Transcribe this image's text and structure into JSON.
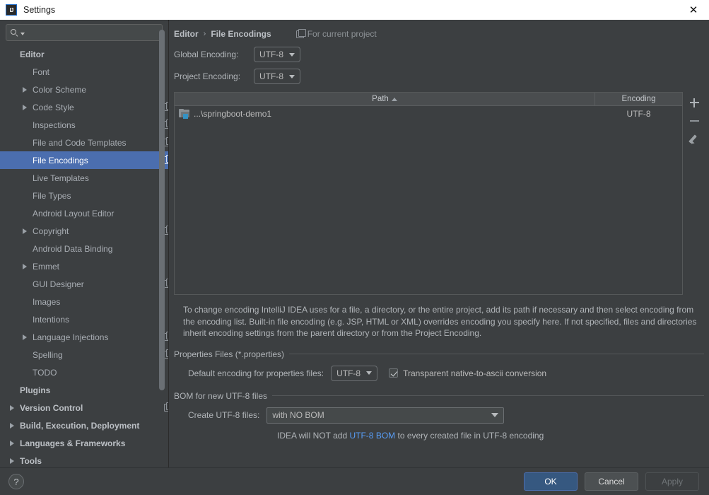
{
  "window": {
    "title": "Settings",
    "icon": "intellij-idea-icon",
    "close_label": "✕"
  },
  "sidebar": {
    "search": {
      "value": "",
      "placeholder": "",
      "icon": "search-icon"
    },
    "items": [
      {
        "label": "Editor",
        "level": 1,
        "bold": true,
        "arrow": false,
        "copy": false
      },
      {
        "label": "Font",
        "level": 2,
        "bold": false,
        "arrow": false,
        "copy": false
      },
      {
        "label": "Color Scheme",
        "level": 2,
        "bold": false,
        "arrow": true,
        "copy": false
      },
      {
        "label": "Code Style",
        "level": 2,
        "bold": false,
        "arrow": true,
        "copy": true
      },
      {
        "label": "Inspections",
        "level": 2,
        "bold": false,
        "arrow": false,
        "copy": true
      },
      {
        "label": "File and Code Templates",
        "level": 2,
        "bold": false,
        "arrow": false,
        "copy": true
      },
      {
        "label": "File Encodings",
        "level": 2,
        "bold": false,
        "arrow": false,
        "copy": true,
        "selected": true
      },
      {
        "label": "Live Templates",
        "level": 2,
        "bold": false,
        "arrow": false,
        "copy": false
      },
      {
        "label": "File Types",
        "level": 2,
        "bold": false,
        "arrow": false,
        "copy": false
      },
      {
        "label": "Android Layout Editor",
        "level": 2,
        "bold": false,
        "arrow": false,
        "copy": false
      },
      {
        "label": "Copyright",
        "level": 2,
        "bold": false,
        "arrow": true,
        "copy": true
      },
      {
        "label": "Android Data Binding",
        "level": 2,
        "bold": false,
        "arrow": false,
        "copy": false
      },
      {
        "label": "Emmet",
        "level": 2,
        "bold": false,
        "arrow": true,
        "copy": false
      },
      {
        "label": "GUI Designer",
        "level": 2,
        "bold": false,
        "arrow": false,
        "copy": true
      },
      {
        "label": "Images",
        "level": 2,
        "bold": false,
        "arrow": false,
        "copy": false
      },
      {
        "label": "Intentions",
        "level": 2,
        "bold": false,
        "arrow": false,
        "copy": false
      },
      {
        "label": "Language Injections",
        "level": 2,
        "bold": false,
        "arrow": true,
        "copy": true
      },
      {
        "label": "Spelling",
        "level": 2,
        "bold": false,
        "arrow": false,
        "copy": true
      },
      {
        "label": "TODO",
        "level": 2,
        "bold": false,
        "arrow": false,
        "copy": false
      },
      {
        "label": "Plugins",
        "level": 1,
        "bold": true,
        "arrow": false,
        "copy": false
      },
      {
        "label": "Version Control",
        "level": 1,
        "bold": true,
        "arrow": true,
        "copy": true
      },
      {
        "label": "Build, Execution, Deployment",
        "level": 1,
        "bold": true,
        "arrow": true,
        "copy": false
      },
      {
        "label": "Languages & Frameworks",
        "level": 1,
        "bold": true,
        "arrow": true,
        "copy": false
      },
      {
        "label": "Tools",
        "level": 1,
        "bold": true,
        "arrow": true,
        "copy": false
      }
    ]
  },
  "main": {
    "breadcrumb": {
      "parent": "Editor",
      "separator": "›",
      "current": "File Encodings"
    },
    "for_current_project": "For current project",
    "global_encoding": {
      "label": "Global Encoding:",
      "value": "UTF-8"
    },
    "project_encoding": {
      "label": "Project Encoding:",
      "value": "UTF-8"
    },
    "table": {
      "columns": [
        "Path",
        "Encoding"
      ],
      "sort_column": "Path",
      "sort_direction": "ascending",
      "rows": [
        {
          "path": "...\\springboot-demo1",
          "encoding": "UTF-8"
        }
      ]
    },
    "tools": {
      "add": "+",
      "remove": "−",
      "edit": "edit"
    },
    "description": "To change encoding IntelliJ IDEA uses for a file, a directory, or the entire project, add its path if necessary and then select encoding from the encoding list. Built-in file encoding (e.g. JSP, HTML or XML) overrides encoding you specify here. If not specified, files and directories inherit encoding settings from the parent directory or from the Project Encoding.",
    "properties_group": {
      "title": "Properties Files (*.properties)",
      "default_encoding_label": "Default encoding for properties files:",
      "default_encoding_value": "UTF-8",
      "transparent_label": "Transparent native-to-ascii conversion",
      "transparent_checked": true
    },
    "bom_group": {
      "title": "BOM for new UTF-8 files",
      "create_label": "Create UTF-8 files:",
      "create_value": "with NO BOM",
      "note_prefix": "IDEA will NOT add ",
      "note_link": "UTF-8 BOM",
      "note_suffix": " to every created file in UTF-8 encoding"
    }
  },
  "footer": {
    "help": "?",
    "ok": "OK",
    "cancel": "Cancel",
    "apply": "Apply"
  },
  "colors": {
    "selection": "#4b6eaf",
    "accent_link": "#589df6",
    "default_button": "#365880",
    "panel_bg": "#3c3f41"
  }
}
